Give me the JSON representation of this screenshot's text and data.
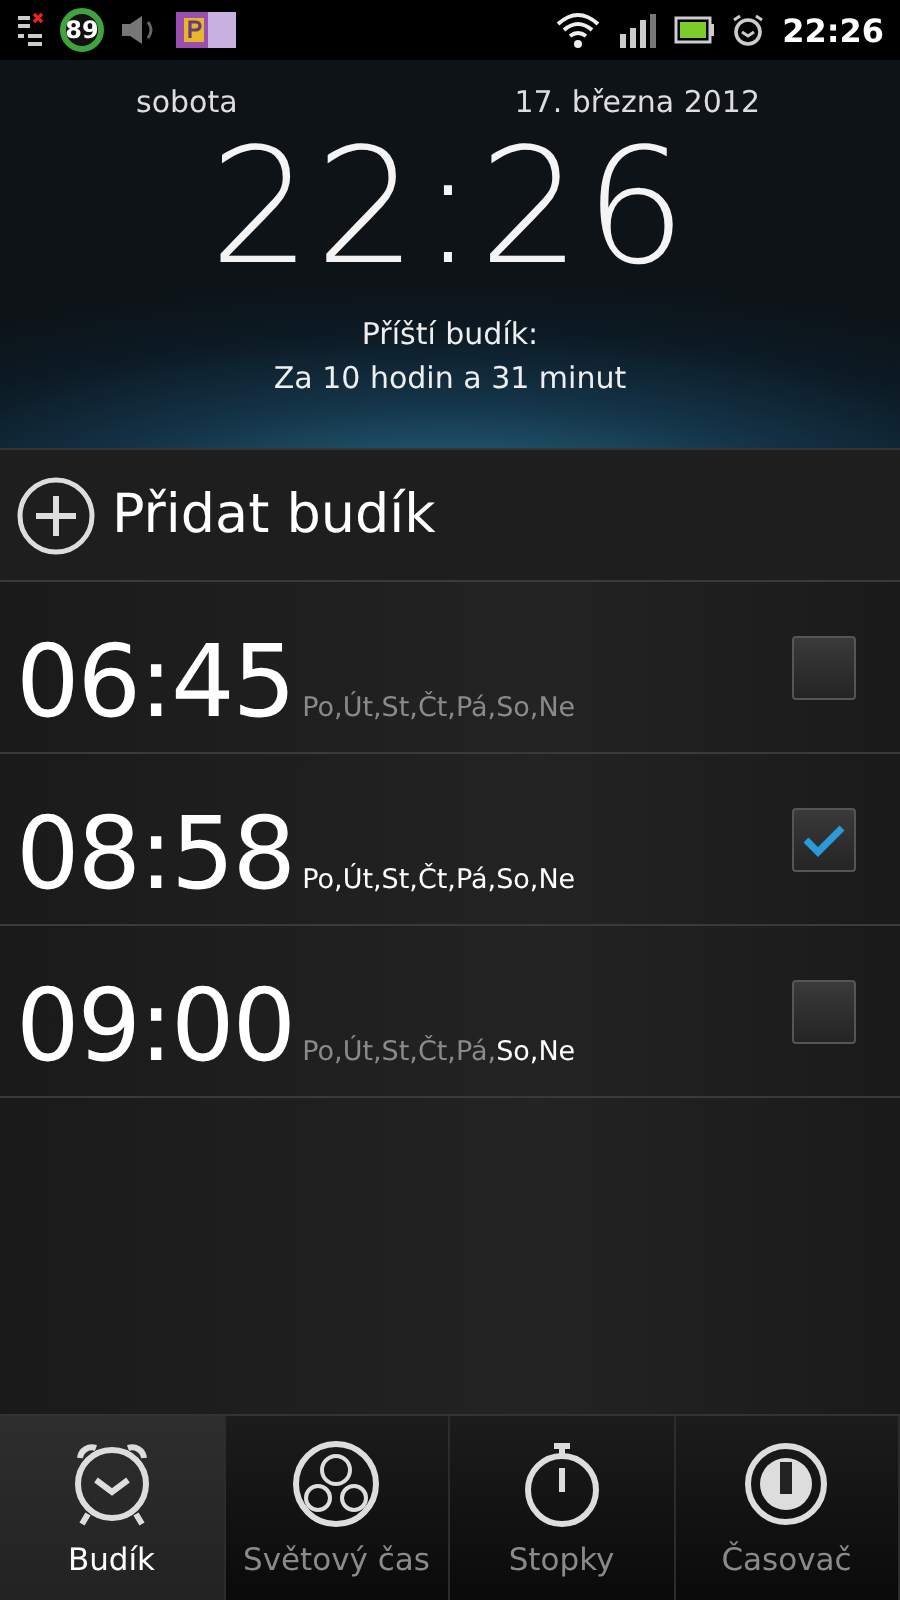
{
  "status_bar": {
    "battery_badge": "89",
    "time": "22:26"
  },
  "header": {
    "day": "sobota",
    "date": "17. března 2012",
    "time": "22:26",
    "next_label": "Příští budík:",
    "next_value": "Za 10 hodin a 31 minut"
  },
  "add_alarm": {
    "label": "Přidat budík"
  },
  "alarms": [
    {
      "time": "06:45",
      "checked": false,
      "days": [
        {
          "label": "Po,",
          "on": false
        },
        {
          "label": "Út,",
          "on": false
        },
        {
          "label": "St,",
          "on": false
        },
        {
          "label": "Čt,",
          "on": false
        },
        {
          "label": "Pá,",
          "on": false
        },
        {
          "label": "So,",
          "on": false
        },
        {
          "label": "Ne",
          "on": false
        }
      ]
    },
    {
      "time": "08:58",
      "checked": true,
      "days": [
        {
          "label": "Po,",
          "on": true
        },
        {
          "label": "Út,",
          "on": true
        },
        {
          "label": "St,",
          "on": true
        },
        {
          "label": "Čt,",
          "on": true
        },
        {
          "label": "Pá,",
          "on": true
        },
        {
          "label": "So,",
          "on": true
        },
        {
          "label": "Ne",
          "on": true
        }
      ]
    },
    {
      "time": "09:00",
      "checked": false,
      "days": [
        {
          "label": "Po,",
          "on": false
        },
        {
          "label": "Út,",
          "on": false
        },
        {
          "label": "St,",
          "on": false
        },
        {
          "label": "Čt,",
          "on": false
        },
        {
          "label": "Pá,",
          "on": false
        },
        {
          "label": "So,",
          "on": true
        },
        {
          "label": "Ne",
          "on": true
        }
      ]
    }
  ],
  "tabs": [
    {
      "label": "Budík",
      "kind": "alarm",
      "selected": true
    },
    {
      "label": "Světový čas",
      "kind": "world",
      "selected": false
    },
    {
      "label": "Stopky",
      "kind": "stopwatch",
      "selected": false
    },
    {
      "label": "Časovač",
      "kind": "timer",
      "selected": false
    }
  ]
}
